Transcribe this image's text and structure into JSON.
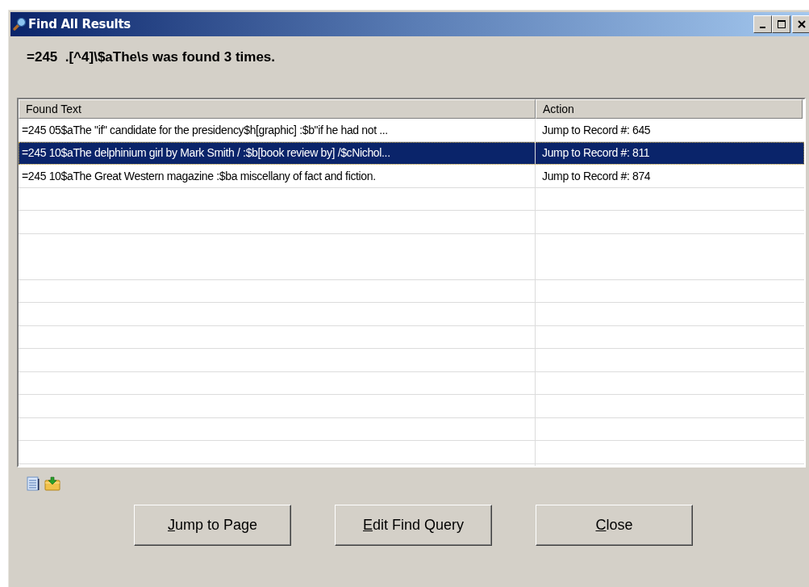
{
  "window": {
    "title": "Find All Results"
  },
  "summary": "=245  .[^4]\\$aThe\\s was found 3 times.",
  "table": {
    "columns": [
      "Found Text",
      "Action"
    ],
    "rows": [
      {
        "cells": [
          "=245  05$aThe \"if\" candidate for the presidency$h[graphic] :$b\"if he had not ...",
          "Jump to Record #: 645"
        ],
        "selected": false
      },
      {
        "cells": [
          "=245  10$aThe delphinium girl by Mark Smith / :$b[book review by] /$cNichol...",
          "Jump to Record #: 811"
        ],
        "selected": true
      },
      {
        "cells": [
          "=245  10$aThe Great Western magazine :$ba miscellany of fact and fiction.",
          "Jump to Record #: 874"
        ],
        "selected": false
      }
    ]
  },
  "buttons": [
    {
      "label": "Jump to Page",
      "mnemonic": true
    },
    {
      "label": "Edit Find Query",
      "mnemonic": true
    },
    {
      "label": "Close",
      "mnemonic": true
    }
  ]
}
